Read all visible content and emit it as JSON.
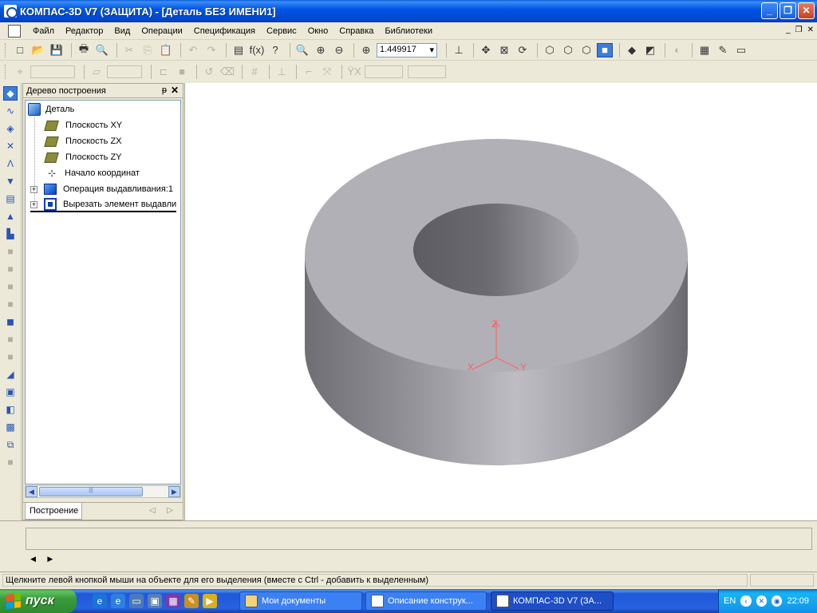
{
  "window": {
    "title": "КОМПАС-3D V7 (ЗАЩИТА) - [Деталь БЕЗ ИМЕНИ1]",
    "controls": {
      "minimize": "_",
      "restore": "❐",
      "close": "✕"
    }
  },
  "menu": {
    "items": [
      "Файл",
      "Редактор",
      "Вид",
      "Операции",
      "Спецификация",
      "Сервис",
      "Окно",
      "Справка",
      "Библиотеки"
    ],
    "doc_controls": [
      "_",
      "❐",
      "✕"
    ]
  },
  "toolbar": {
    "zoom_value": "1.449917",
    "zoom_arrow": "▾"
  },
  "tree_panel": {
    "title": "Дерево построения",
    "pin_icon": "ᵽ",
    "close_label": "✕",
    "expander_label": "+",
    "items": [
      {
        "label": "Деталь",
        "icon": "part-icon"
      },
      {
        "label": "Плоскость XY",
        "icon": "plane-icon"
      },
      {
        "label": "Плоскость ZX",
        "icon": "plane-icon"
      },
      {
        "label": "Плоскость ZY",
        "icon": "plane-icon"
      },
      {
        "label": "Начало координат",
        "icon": "origin-icon"
      },
      {
        "label": "Операция выдавливания:1",
        "icon": "extrude-icon"
      },
      {
        "label": "Вырезать элемент выдавли",
        "icon": "cut-extrude-icon"
      }
    ],
    "scroll_left": "◀",
    "scroll_right": "▶",
    "scroll_thumb_grip": "|||",
    "tab_label": "Построение",
    "tab_arrows": "◁ ▷"
  },
  "viewport": {
    "axes": {
      "z": "Z",
      "x": "X",
      "y": "Y"
    },
    "colors": {
      "top_face": "#b0b0b6",
      "side_dark": "#6e6e74",
      "side_light": "#bdbdc3",
      "axis": "#ff6060"
    }
  },
  "bottom": {
    "nav_arrows": "◀ ▶",
    "status_text": "Щелкните левой кнопкой мыши на объекте для его выделения (вместе с Ctrl - добавить к выделенным)"
  },
  "taskbar": {
    "start_label": "пуск",
    "tasks": [
      {
        "label": "Мои документы",
        "active": false
      },
      {
        "label": "Описание конструк...",
        "active": false
      },
      {
        "label": "КОМПАС-3D V7 (ЗА...",
        "active": true
      }
    ],
    "lang": "EN",
    "clock": "22:09"
  }
}
